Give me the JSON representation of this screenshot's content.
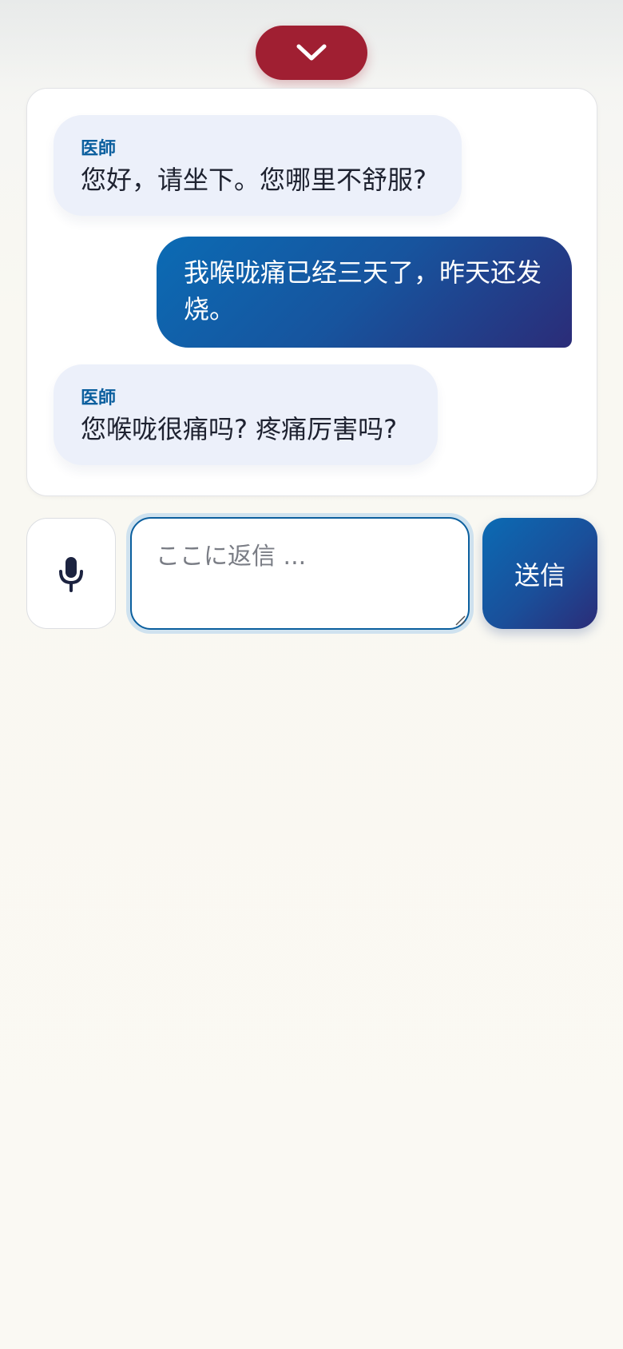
{
  "header": {
    "collapse_icon": "chevron-down-icon"
  },
  "messages": [
    {
      "role": "doctor",
      "sender": "医師",
      "text": "您好，请坐下。您哪里不舒服?"
    },
    {
      "role": "user",
      "line1": "我喉咙痛已经三天了，昨天还发",
      "line2": "烧。"
    },
    {
      "role": "doctor",
      "sender": "医師",
      "text": "您喉咙很痛吗? 疼痛厉害吗?"
    }
  ],
  "composer": {
    "mic_icon": "microphone-icon",
    "placeholder": "ここに返信 ...",
    "value": "",
    "send_label": "送信"
  },
  "colors": {
    "accent_red": "#a01f32",
    "accent_blue": "#0b6bb4",
    "accent_navy": "#2b2c78",
    "doctor_bubble": "#ecf0fa",
    "sender_label": "#0b5f9e"
  }
}
